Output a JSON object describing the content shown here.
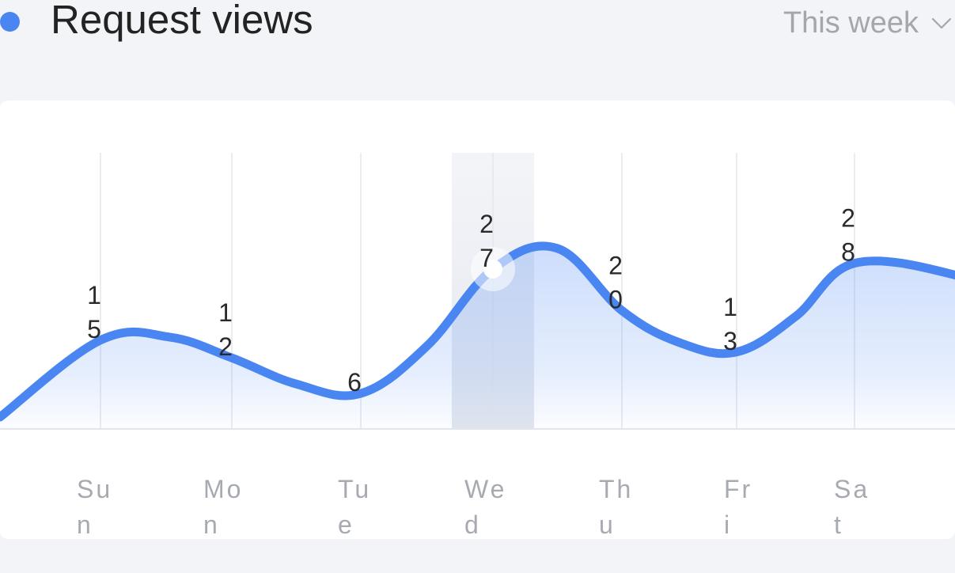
{
  "header": {
    "title": "Request views",
    "period_label": "This week",
    "period_icon": "chevron-down-icon",
    "accent_color": "#4a86f2"
  },
  "chart_data": {
    "type": "area",
    "categories": [
      "Sun",
      "Mon",
      "Tue",
      "Wed",
      "Thu",
      "Fri",
      "Sat"
    ],
    "category_label_lines": [
      [
        "Su",
        "n"
      ],
      [
        "Mo",
        "n"
      ],
      [
        "Tu",
        "e"
      ],
      [
        "We",
        "d"
      ],
      [
        "Th",
        "u"
      ],
      [
        "Fr",
        "i"
      ],
      [
        "Sa",
        "t"
      ]
    ],
    "values": [
      15,
      12,
      6,
      27,
      20,
      13,
      28
    ],
    "value_label_lines": [
      [
        "1",
        "5"
      ],
      [
        "1",
        "2"
      ],
      [
        "6"
      ],
      [
        "2",
        "7"
      ],
      [
        "2",
        "0"
      ],
      [
        "1",
        "3"
      ],
      [
        "2",
        "8"
      ]
    ],
    "highlighted_category": "Wed",
    "line_color": "#4a86f2",
    "fill_color": "#4a86f2",
    "grid": true,
    "legend": false,
    "title": "",
    "xlabel": "",
    "ylabel": ""
  }
}
